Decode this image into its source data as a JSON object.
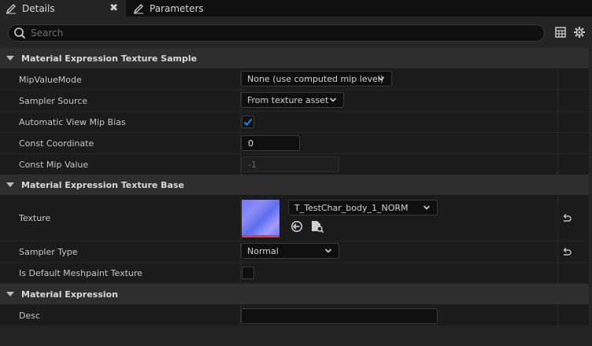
{
  "tabs": {
    "details_label": "Details",
    "close_glyph": "✖",
    "parameters_label": "Parameters",
    "details_icon": "pencil-icon",
    "parameters_icon": "pencil-icon"
  },
  "search": {
    "placeholder": "Search",
    "value": ""
  },
  "toolbar": {
    "table_icon": "table-view-icon",
    "settings_icon": "gear-icon"
  },
  "sections": {
    "texture_sample": {
      "title": "Material Expression Texture Sample",
      "mip_value_mode": {
        "label": "MipValueMode",
        "value": "None (use computed mip level)"
      },
      "sampler_source": {
        "label": "Sampler Source",
        "value": "From texture asset"
      },
      "auto_view_mip_bias": {
        "label": "Automatic View Mip Bias",
        "checked": true
      },
      "const_coordinate": {
        "label": "Const Coordinate",
        "value": "0"
      },
      "const_mip_value": {
        "label": "Const Mip Value",
        "value": "-1"
      }
    },
    "texture_base": {
      "title": "Material Expression Texture Base",
      "texture": {
        "label": "Texture",
        "asset": "T_TestChar_body_1_NORM"
      },
      "sampler_type": {
        "label": "Sampler Type",
        "value": "Normal"
      },
      "is_default_meshpaint": {
        "label": "Is Default Meshpaint Texture",
        "checked": false
      }
    },
    "expression": {
      "title": "Material Expression",
      "desc": {
        "label": "Desc",
        "value": ""
      }
    }
  },
  "colors": {
    "accent": "#1f8ef1",
    "panel": "#242424",
    "row": "#1b1b1b",
    "section": "#2e2e2e"
  }
}
